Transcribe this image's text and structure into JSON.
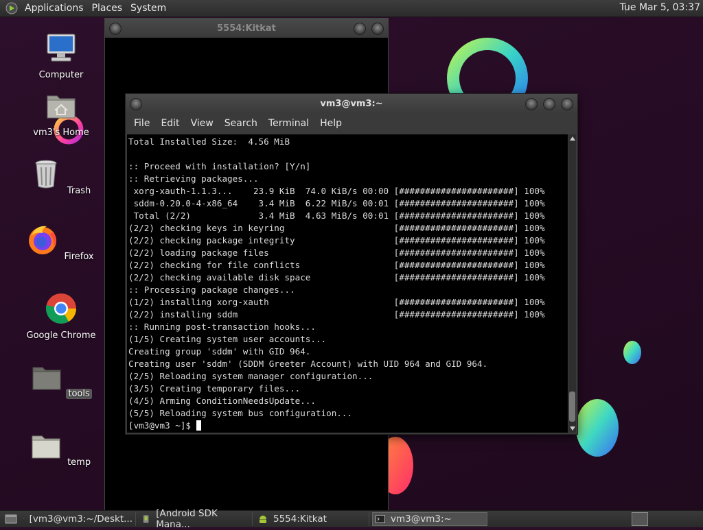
{
  "top_panel": {
    "menus": [
      "Applications",
      "Places",
      "System"
    ],
    "clock": "Tue Mar  5, 03:37"
  },
  "desktop_icons": [
    {
      "label": "Computer",
      "icon": "computer-icon"
    },
    {
      "label": "vm3's Home",
      "icon": "home-folder-icon"
    },
    {
      "label": "Trash",
      "icon": "trash-icon"
    },
    {
      "label": "Firefox",
      "icon": "firefox-icon"
    },
    {
      "label": "Google Chrome",
      "icon": "chrome-icon"
    },
    {
      "label": "tools",
      "icon": "folder-icon"
    },
    {
      "label": "temp",
      "icon": "folder-icon"
    }
  ],
  "kitkat_window": {
    "title": "5554:Kitkat"
  },
  "terminal": {
    "title": "vm3@vm3:~",
    "menu": [
      "File",
      "Edit",
      "View",
      "Search",
      "Terminal",
      "Help"
    ],
    "lines": [
      "Total Installed Size:  4.56 MiB",
      "",
      ":: Proceed with installation? [Y/n]",
      ":: Retrieving packages...",
      " xorg-xauth-1.1.3...    23.9 KiB  74.0 KiB/s 00:00 [######################] 100%",
      " sddm-0.20.0-4-x86_64    3.4 MiB  6.22 MiB/s 00:01 [######################] 100%",
      " Total (2/2)             3.4 MiB  4.63 MiB/s 00:01 [######################] 100%",
      "(2/2) checking keys in keyring                     [######################] 100%",
      "(2/2) checking package integrity                   [######################] 100%",
      "(2/2) loading package files                        [######################] 100%",
      "(2/2) checking for file conflicts                  [######################] 100%",
      "(2/2) checking available disk space                [######################] 100%",
      ":: Processing package changes...",
      "(1/2) installing xorg-xauth                        [######################] 100%",
      "(2/2) installing sddm                              [######################] 100%",
      ":: Running post-transaction hooks...",
      "(1/5) Creating system user accounts...",
      "Creating group 'sddm' with GID 964.",
      "Creating user 'sddm' (SDDM Greeter Account) with UID 964 and GID 964.",
      "(2/5) Reloading system manager configuration...",
      "(3/5) Creating temporary files...",
      "(4/5) Arming ConditionNeedsUpdate...",
      "(5/5) Reloading system bus configuration..."
    ],
    "prompt": "[vm3@vm3 ~]$ "
  },
  "taskbar": {
    "items": [
      {
        "label": "[vm3@vm3:~/Deskt...",
        "icon": "terminal-icon",
        "active": false
      },
      {
        "label": "[Android SDK Mana...",
        "icon": "android-sdk-icon",
        "active": false
      },
      {
        "label": "5554:Kitkat",
        "icon": "android-icon",
        "active": false
      },
      {
        "label": "vm3@vm3:~",
        "icon": "terminal-icon",
        "active": true
      }
    ]
  }
}
